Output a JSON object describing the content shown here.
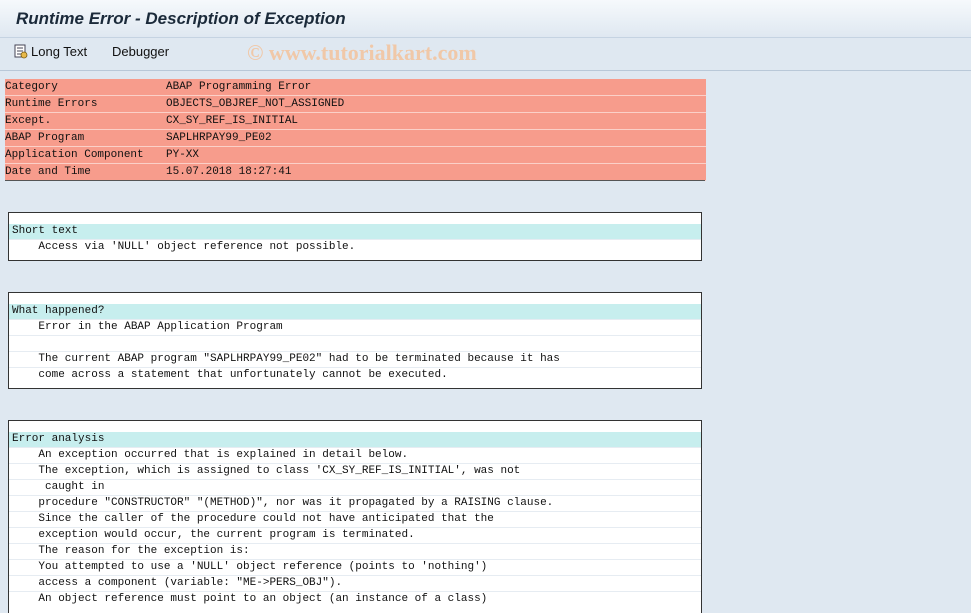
{
  "window": {
    "title": "Runtime Error - Description of Exception"
  },
  "toolbar": {
    "long_text_label": "Long Text",
    "long_text_icon": "long-text-icon",
    "debugger_label": "Debugger"
  },
  "watermark": "© www.tutorialkart.com",
  "header": [
    {
      "key": "Category",
      "value": "ABAP Programming Error"
    },
    {
      "key": "Runtime Errors",
      "value": "OBJECTS_OBJREF_NOT_ASSIGNED"
    },
    {
      "key": "Except.",
      "value": "CX_SY_REF_IS_INITIAL"
    },
    {
      "key": "ABAP Program",
      "value": "SAPLHRPAY99_PE02"
    },
    {
      "key": "Application Component",
      "value": "PY-XX"
    },
    {
      "key": "Date and Time",
      "value": "15.07.2018 18:27:41"
    }
  ],
  "short_text": {
    "heading": "Short text",
    "lines": [
      "    Access via 'NULL' object reference not possible."
    ]
  },
  "what_happened": {
    "heading": "What happened?",
    "lines": [
      "    Error in the ABAP Application Program",
      "",
      "    The current ABAP program \"SAPLHRPAY99_PE02\" had to be terminated because it has",
      "    come across a statement that unfortunately cannot be executed."
    ]
  },
  "error_analysis": {
    "heading": "Error analysis",
    "lines": [
      "    An exception occurred that is explained in detail below.",
      "    The exception, which is assigned to class 'CX_SY_REF_IS_INITIAL', was not",
      "     caught in",
      "    procedure \"CONSTRUCTOR\" \"(METHOD)\", nor was it propagated by a RAISING clause.",
      "    Since the caller of the procedure could not have anticipated that the",
      "    exception would occur, the current program is terminated.",
      "    The reason for the exception is:",
      "    You attempted to use a 'NULL' object reference (points to 'nothing')",
      "    access a component (variable: \"ME->PERS_OBJ\").",
      "    An object reference must point to an object (an instance of a class)"
    ]
  },
  "colors": {
    "header_bg": "#f79c8c",
    "section_head_bg": "#c7eeee",
    "background": "#dfe8f1"
  }
}
